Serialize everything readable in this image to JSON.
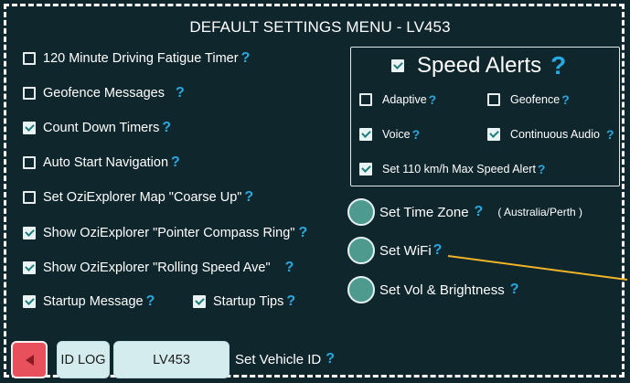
{
  "title": "DEFAULT SETTINGS MENU - LV453",
  "help_glyph": "?",
  "settings": [
    {
      "label": "120 Minute Driving Fatigue Timer",
      "checked": false
    },
    {
      "label": "Geofence Messages",
      "checked": false
    },
    {
      "label": "Count Down Timers",
      "checked": true
    },
    {
      "label": "Auto Start Navigation",
      "checked": false
    },
    {
      "label": "Set OziExplorer Map \"Coarse Up\"",
      "checked": false
    },
    {
      "label": "Show OziExplorer \"Pointer Compass Ring\"",
      "checked": true
    },
    {
      "label": "Show OziExplorer \"Rolling Speed Ave\"",
      "checked": true
    },
    {
      "label": "Startup Message",
      "checked": true
    },
    {
      "label": "Startup Tips",
      "checked": true
    }
  ],
  "speed_alerts": {
    "title": "Speed Alerts",
    "enabled": true,
    "options": [
      {
        "label": "Adaptive",
        "checked": false
      },
      {
        "label": "Geofence",
        "checked": false
      },
      {
        "label": "Voice",
        "checked": true
      },
      {
        "label": "Continuous Audio",
        "checked": true
      },
      {
        "label": "Set 110 km/h Max Speed Alert",
        "checked": true
      }
    ]
  },
  "actions": {
    "timezone_label": "Set Time Zone",
    "timezone_value": "( Australia/Perth )",
    "wifi_label": "Set WiFi",
    "vol_label": "Set Vol & Brightness"
  },
  "bottom": {
    "id_log_label": "ID LOG",
    "vehicle_id_value": "LV453",
    "vehicle_id_label": "Set Vehicle ID"
  },
  "colors": {
    "background": "#0f262d",
    "help": "#2aa9e0",
    "circle_button": "#4e9a8f",
    "back_button": "#e8505b",
    "light_button": "#d5ecee",
    "pointer_line": "#f0b429"
  },
  "icons": {
    "back": "triangle-left-icon",
    "help": "question-mark-icon",
    "checkbox": "checkbox-icon"
  }
}
